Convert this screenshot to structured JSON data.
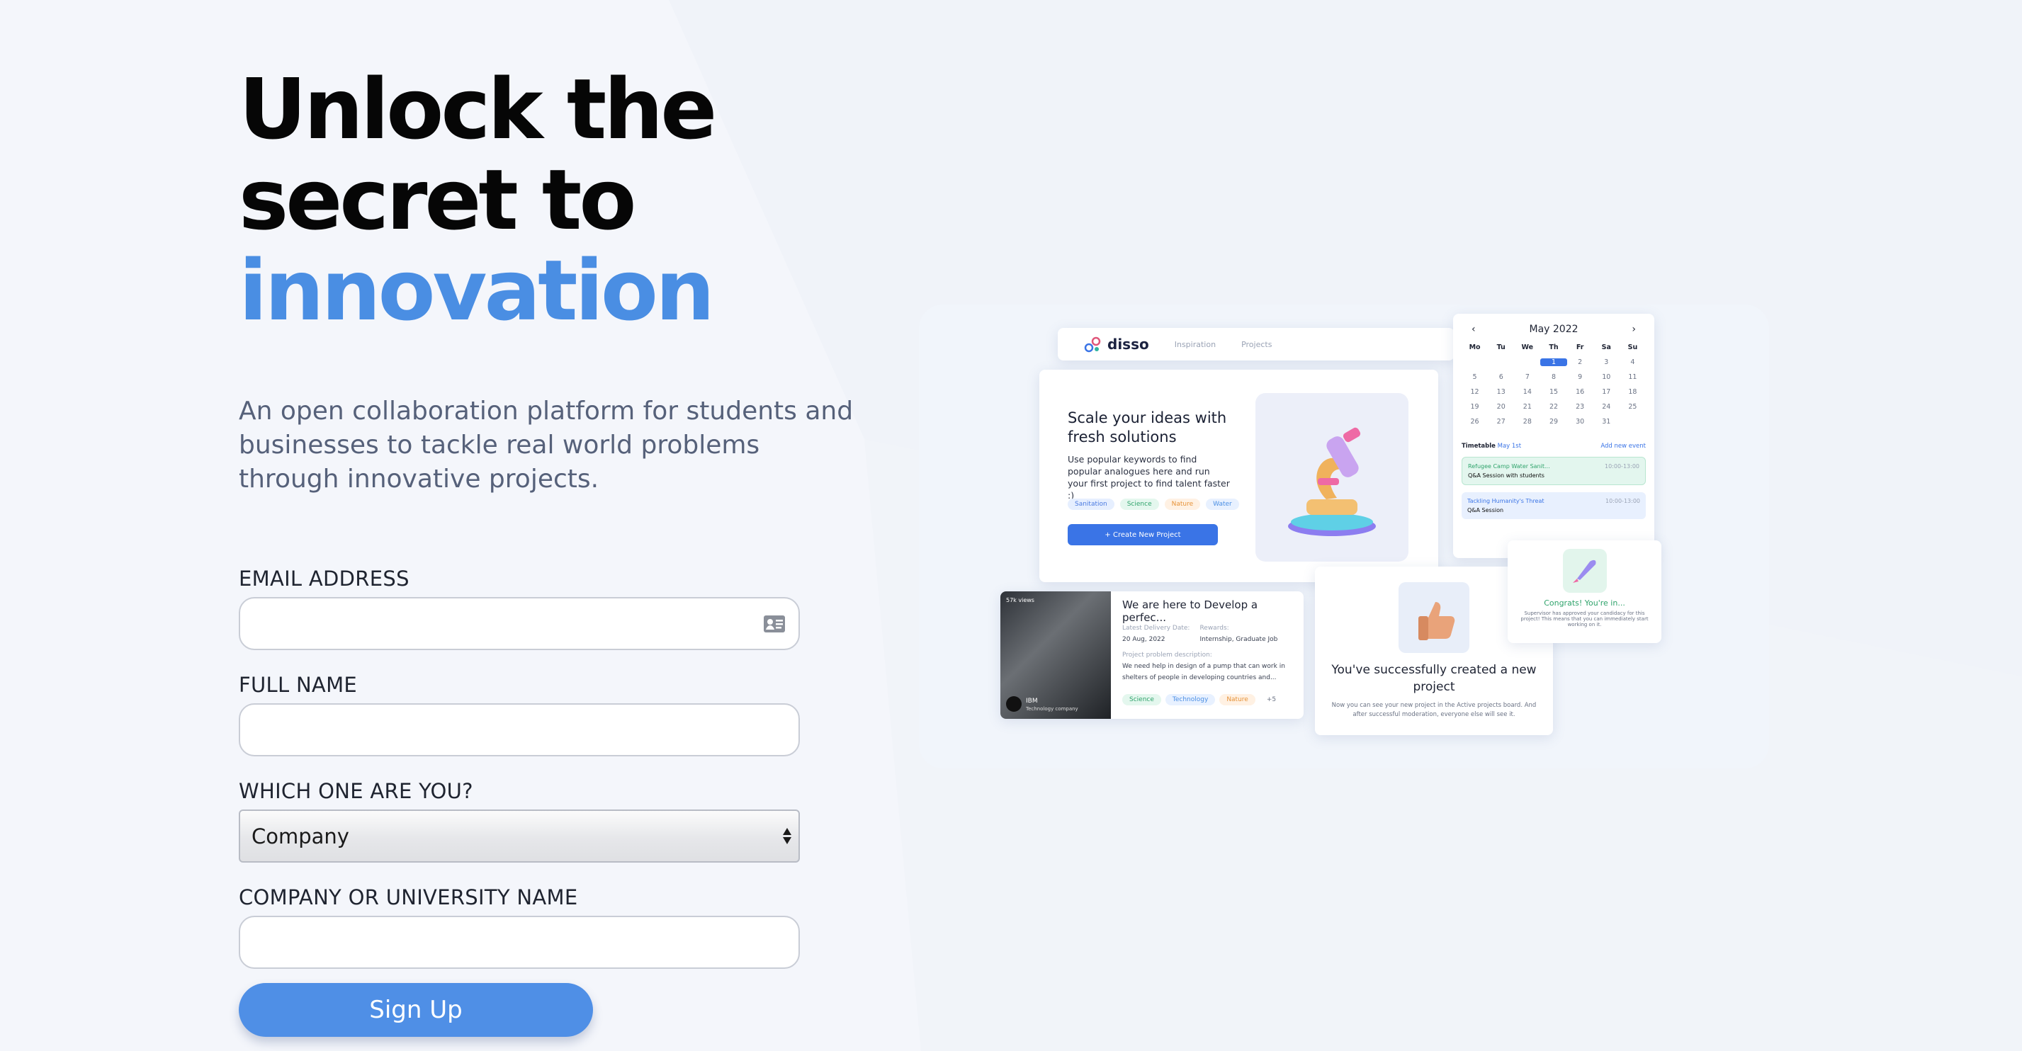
{
  "hero": {
    "line1": "Unlock the",
    "line2": "secret to",
    "accent": "innovation"
  },
  "lead": "An open collaboration platform for students and businesses to tackle real world problems through innovative projects.",
  "form": {
    "email_label": "EMAIL ADDRESS",
    "email_value": "",
    "fullname_label": "FULL NAME",
    "fullname_value": "",
    "role_label": "WHICH ONE ARE YOU?",
    "role_value": "Company",
    "org_label": "COMPANY OR UNIVERSITY NAME",
    "org_value": "",
    "submit_label": "Sign Up"
  },
  "illustration": {
    "brand": "disso",
    "nav": [
      "Inspiration",
      "Projects"
    ],
    "main_card": {
      "title": "Scale your ideas with fresh solutions",
      "desc": "Use popular keywords to find popular analogues here and run your first project to find talent faster :)",
      "tags": [
        "Sanitation",
        "Science",
        "Nature",
        "Water"
      ],
      "button": "+ Create New Project"
    },
    "calendar": {
      "month": "May 2022",
      "days": [
        "Mo",
        "Tu",
        "We",
        "Th",
        "Fr",
        "Sa",
        "Su"
      ],
      "dates": [
        "",
        "",
        "",
        "1",
        "2",
        "3",
        "4",
        "5",
        "6",
        "7",
        "8",
        "9",
        "10",
        "11",
        "12",
        "13",
        "14",
        "15",
        "16",
        "17",
        "18",
        "19",
        "20",
        "21",
        "22",
        "23",
        "24",
        "25",
        "26",
        "27",
        "28",
        "29",
        "30",
        "31",
        ""
      ],
      "selected": "1",
      "timetable": "Timetable",
      "timetable_date": "May 1st",
      "add_event": "Add new event",
      "events": [
        {
          "title": "Refugee Camp Water Sanit...",
          "time": "10:00-13:00",
          "sub": "Q&A Session with students"
        },
        {
          "title": "Tackling Humanity's Threat",
          "time": "10:00-13:00",
          "sub": "Q&A Session"
        }
      ]
    },
    "congrats": {
      "title": "Congrats! You're in...",
      "text": "Supervisor has approved your candidacy for this project! This means that you can immediately start working on it."
    },
    "project": {
      "views": "57k views",
      "company": "IBM",
      "company_sub": "Technology company",
      "title": "We are here to Develop a perfec...",
      "delivery_label": "Latest Delivery Date:",
      "delivery": "20 Aug, 2022",
      "rewards_label": "Rewards:",
      "rewards": "Internship, Graduate Job",
      "problem_label": "Project problem description:",
      "problem": "We need help in design of a pump that can work in shelters of people in developing countries and...",
      "tags": [
        "Science",
        "Technology",
        "Nature",
        "+5"
      ]
    },
    "success": {
      "title": "You've successfully created a new project",
      "text": "Now you can see your new project in the Active projects board. And after successful moderation, everyone else will see it."
    }
  }
}
